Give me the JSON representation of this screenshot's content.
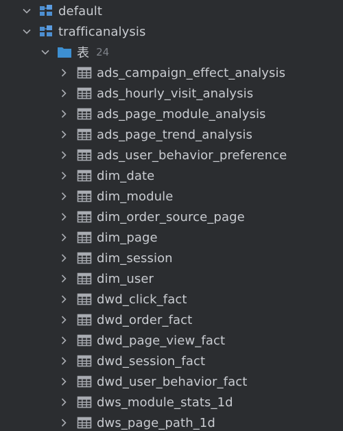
{
  "tree": {
    "schemas": [
      {
        "label": "default",
        "expanded": true,
        "icon": "schema-icon"
      },
      {
        "label": "trafficanalysis",
        "expanded": true,
        "icon": "schema-icon"
      }
    ],
    "folder": {
      "label": "表",
      "count": "24",
      "icon": "folder-icon",
      "expanded": true
    },
    "tables": [
      {
        "label": "ads_campaign_effect_analysis",
        "icon": "table-icon"
      },
      {
        "label": "ads_hourly_visit_analysis",
        "icon": "table-icon"
      },
      {
        "label": "ads_page_module_analysis",
        "icon": "table-icon"
      },
      {
        "label": "ads_page_trend_analysis",
        "icon": "table-icon"
      },
      {
        "label": "ads_user_behavior_preference",
        "icon": "table-icon"
      },
      {
        "label": "dim_date",
        "icon": "table-icon"
      },
      {
        "label": "dim_module",
        "icon": "table-icon"
      },
      {
        "label": "dim_order_source_page",
        "icon": "table-icon"
      },
      {
        "label": "dim_page",
        "icon": "table-icon"
      },
      {
        "label": "dim_session",
        "icon": "table-icon"
      },
      {
        "label": "dim_user",
        "icon": "table-icon"
      },
      {
        "label": "dwd_click_fact",
        "icon": "table-icon"
      },
      {
        "label": "dwd_order_fact",
        "icon": "table-icon"
      },
      {
        "label": "dwd_page_view_fact",
        "icon": "table-icon"
      },
      {
        "label": "dwd_session_fact",
        "icon": "table-icon"
      },
      {
        "label": "dwd_user_behavior_fact",
        "icon": "table-icon"
      },
      {
        "label": "dws_module_stats_1d",
        "icon": "table-icon"
      },
      {
        "label": "dws_page_path_1d",
        "icon": "table-icon"
      }
    ]
  },
  "colors": {
    "background": "#2b2d30",
    "text": "#c9ccd1",
    "count": "#7f838a",
    "schema_icon": "#4d8fd1",
    "folder_icon": "#3d8fd1",
    "table_icon": "#a9acb2",
    "chevron": "#a9acb2"
  }
}
